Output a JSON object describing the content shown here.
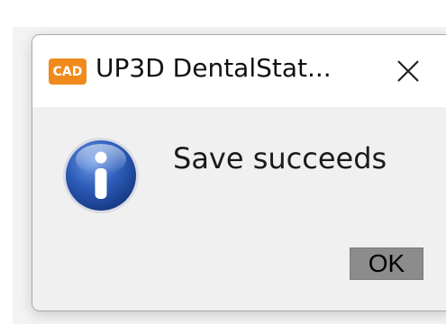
{
  "window": {
    "title": "UP3D DentalStat...",
    "app_icon": {
      "name": "cad-app-icon",
      "label": "CAD",
      "color": "#f08a1c"
    },
    "close_icon": "close-icon"
  },
  "content": {
    "icon": "info-icon",
    "message": "Save succeeds"
  },
  "buttons": {
    "ok_label": "OK"
  },
  "colors": {
    "accent": "#f08a1c",
    "info_blue": "#1f4fa6",
    "button_gray": "#8c8c8c"
  }
}
